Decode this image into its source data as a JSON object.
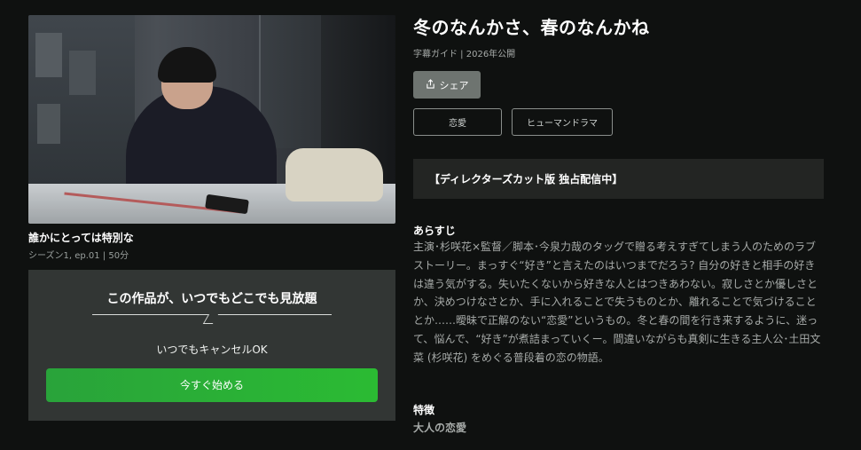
{
  "show": {
    "title": "冬のなんかさ、春のなんかね",
    "meta": "字幕ガイド | 2026年公開",
    "share_label": "シェア",
    "tags": [
      "恋愛",
      "ヒューマンドラマ"
    ],
    "banner": "【ディレクターズカット版 独占配信中】",
    "synopsis_heading": "あらすじ",
    "synopsis": "主演･杉咲花×監督／脚本･今泉力哉のタッグで贈る考えすぎてしまう人のためのラブストーリー。まっすぐ“好き”と言えたのはいつまでだろう? 自分の好きと相手の好きは違う気がする。失いたくないから好きな人とはつきあわない。寂しさとか優しさとか、決めつけなさとか、手に入れることで失うものとか、離れることで気づけることとか……曖昧で正解のない“恋愛”というもの。冬と春の間を行き来するように、迷って、悩んで、“好き”が煮詰まっていくー。間違いながらも真剣に生きる主人公･土田文菜 (杉咲花) をめぐる普段着の恋の物語。",
    "features_heading": "特徴",
    "features_value": "大人の恋愛"
  },
  "episode": {
    "title": "誰かにとっては特別な",
    "meta": "シーズン1, ep.01 | 50分"
  },
  "promo": {
    "headline": "この作品が、いつでもどこでも見放題",
    "subtext": "いつでもキャンセルOK",
    "cta_label": "今すぐ始める"
  },
  "colors": {
    "background": "#0f1110",
    "cta_green": "#2bb335",
    "promo_panel": "#323634",
    "share_button": "#6e7470"
  },
  "icons": {
    "share": "share-icon"
  }
}
